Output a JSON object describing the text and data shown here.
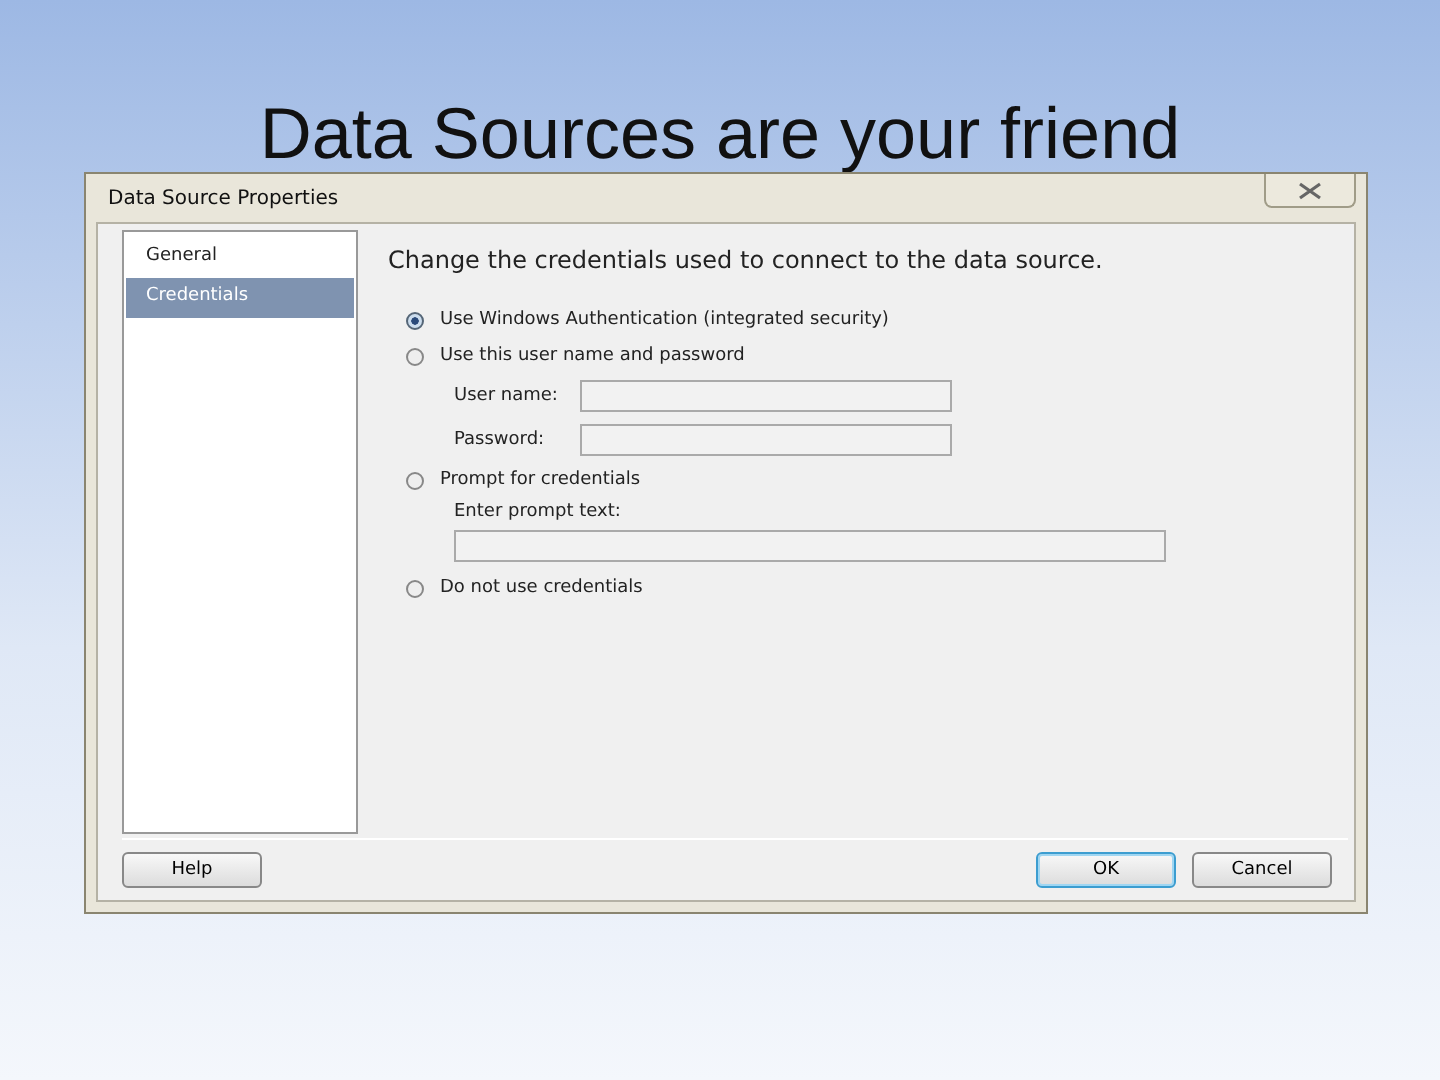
{
  "slide": {
    "title": "Data Sources are your friend"
  },
  "window": {
    "title": "Data Source Properties"
  },
  "nav": [
    {
      "label": "General",
      "selected": false
    },
    {
      "label": "Credentials",
      "selected": true
    }
  ],
  "heading": "Change the credentials used to connect to the data source.",
  "options": [
    {
      "label": "Use Windows Authentication (integrated security)",
      "selected": true
    },
    {
      "label": "Use this user name and password",
      "selected": false,
      "fields": [
        {
          "kind": "inline",
          "label": "User name:"
        },
        {
          "kind": "inline",
          "label": "Password:"
        }
      ]
    },
    {
      "label": "Prompt for credentials",
      "selected": false,
      "fields": [
        {
          "kind": "stacked",
          "label": "Enter prompt text:"
        }
      ]
    },
    {
      "label": "Do not use credentials",
      "selected": false
    }
  ],
  "help_button": {
    "label": "Help"
  },
  "buttons": [
    {
      "label": "OK",
      "default": true
    },
    {
      "label": "Cancel",
      "default": false
    }
  ]
}
